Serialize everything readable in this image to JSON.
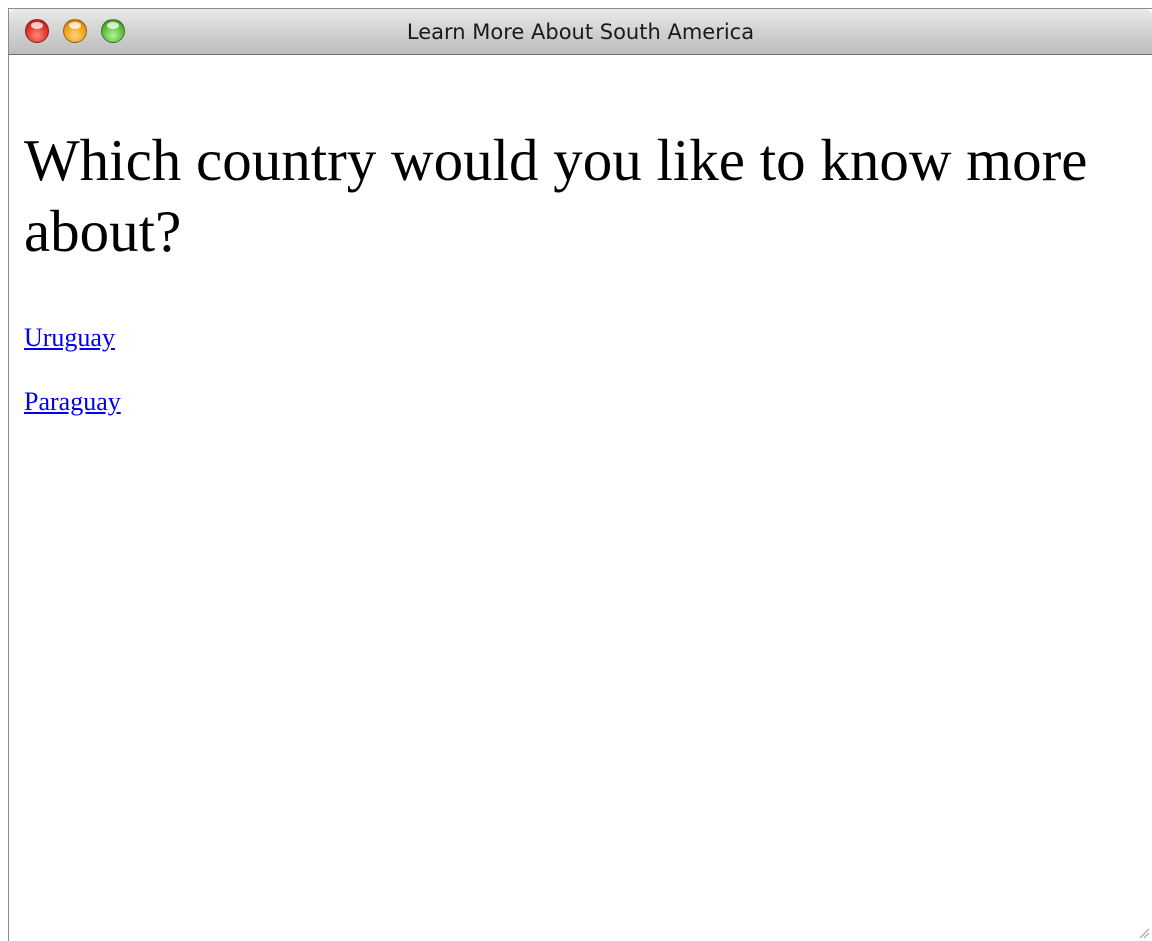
{
  "window": {
    "title": "Learn More About South America"
  },
  "page": {
    "heading": "Which country would you like to know more about?",
    "links": [
      {
        "label": "Uruguay"
      },
      {
        "label": "Paraguay"
      }
    ]
  },
  "colors": {
    "link": "#0000ee",
    "text": "#000000",
    "close": "#e0332a",
    "minimize": "#f0a21c",
    "maximize": "#5cbf38"
  },
  "icons": [
    "close-traffic-light-icon",
    "minimize-traffic-light-icon",
    "zoom-traffic-light-icon",
    "resize-grip-icon"
  ]
}
